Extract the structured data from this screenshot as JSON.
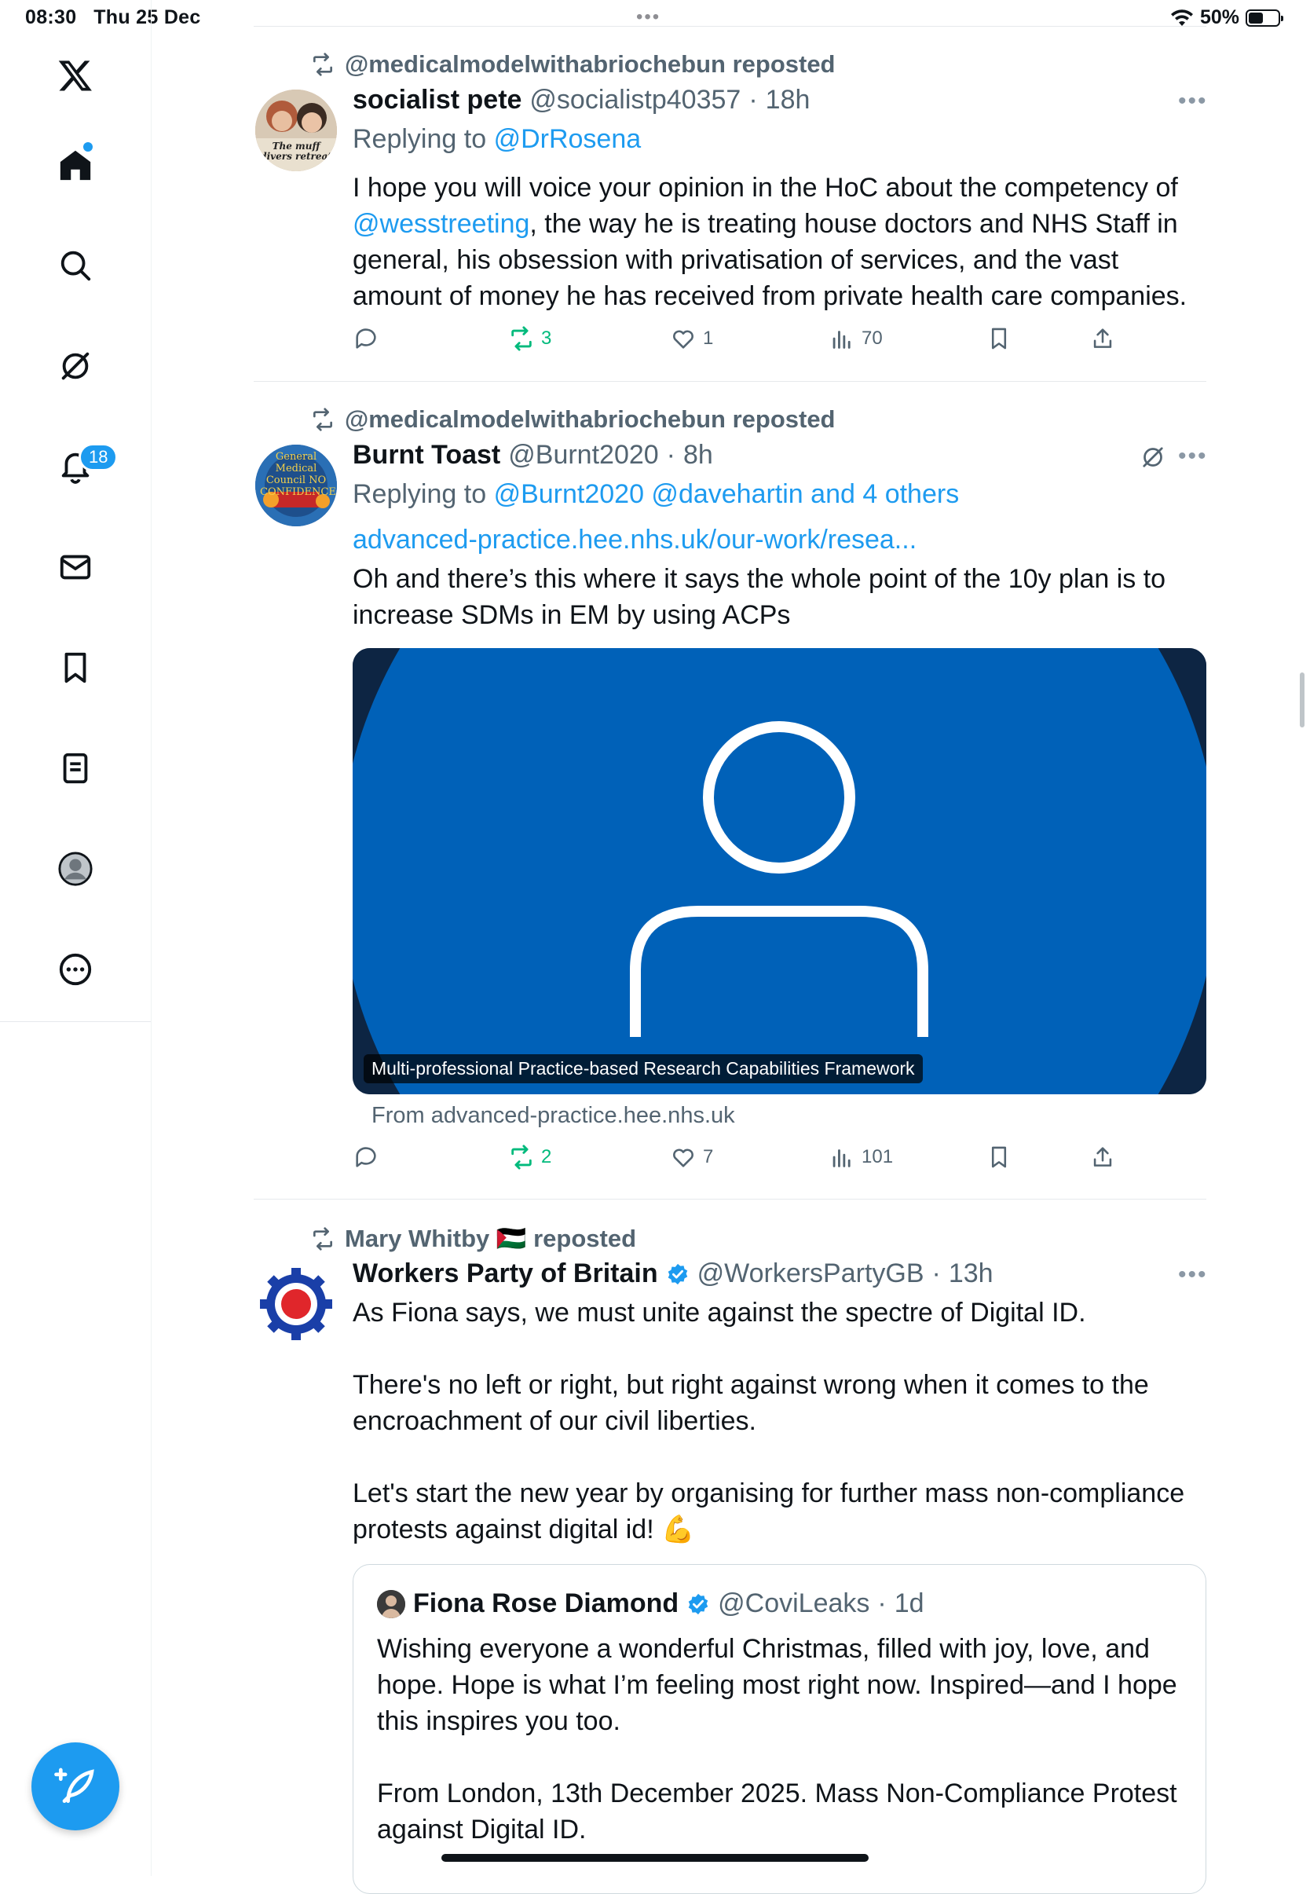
{
  "status_bar": {
    "time": "08:30",
    "date": "Thu 25 Dec",
    "battery": "50%",
    "battery_level": 0.5
  },
  "sidebar": {
    "items": [
      {
        "name": "x-logo"
      },
      {
        "name": "home",
        "has_dot": true
      },
      {
        "name": "search"
      },
      {
        "name": "grok"
      },
      {
        "name": "notifications",
        "badge": "18"
      },
      {
        "name": "messages"
      },
      {
        "name": "bookmarks"
      },
      {
        "name": "lists"
      },
      {
        "name": "profile"
      },
      {
        "name": "more"
      }
    ],
    "notifications_badge": "18"
  },
  "colors": {
    "accent": "#1d9bf0",
    "repost_green": "#00ba7c",
    "muted": "#536471",
    "text": "#0f1419",
    "media_blue": "#0061b8"
  },
  "tweets": [
    {
      "repost_by": "@medicalmodelwithabriochebun reposted",
      "name": "socialist pete",
      "handle": "@socialistp40357",
      "sep": "·",
      "time": "18h",
      "avatar_text": "The muff divers retreat",
      "reply_prefix": "Replying to",
      "reply_to": "@DrRosena",
      "body_1": "I hope you will voice your opinion in the HoC about the competency of",
      "body_mention": "@wesstreeting",
      "body_2": ", the way he is treating house doctors and NHS Staff in general, his obsession with privatisation of services, and the vast amount of money he has received from private health care companies.",
      "reposts": "3",
      "likes": "1",
      "views": "70"
    },
    {
      "repost_by": "@medicalmodelwithabriochebun reposted",
      "name": "Burnt Toast",
      "handle": "@Burnt2020",
      "sep": "·",
      "time": "8h",
      "avatar_text": "General Medical Council NO CONFIDENCE",
      "reply_prefix": "Replying to",
      "reply_to": "@Burnt2020 @davehartin and 4 others",
      "link": "advanced-practice.hee.nhs.uk/our-work/resea...",
      "body": "Oh and there’s this where it says the whole point of the 10y plan is to increase SDMs in EM by using ACPs",
      "media_caption": "Multi-professional Practice-based Research Capabilities Framework",
      "media_source": "From advanced-practice.hee.nhs.uk",
      "reposts": "2",
      "likes": "7",
      "views": "101"
    },
    {
      "repost_by": "Mary Whitby 🇵🇸 reposted",
      "name": "Workers Party of Britain",
      "handle": "@WorkersPartyGB",
      "sep": "·",
      "time": "13h",
      "body": "As Fiona says, we must unite against the spectre of Digital ID.\n\nThere's no left or right, but right against wrong when it comes to the encroachment of our civil liberties.\n\nLet's start the new year by organising for further mass non-compliance protests against digital id! 💪",
      "quote": {
        "name": "Fiona Rose Diamond",
        "handle": "@CoviLeaks",
        "sep": "·",
        "time": "1d",
        "body": "Wishing everyone a wonderful Christmas, filled with joy, love, and hope. Hope is what I’m feeling most right now. Inspired—and I hope this inspires you too.\n\nFrom London, 13th December 2025. Mass Non-Compliance Protest against Digital ID."
      }
    }
  ]
}
